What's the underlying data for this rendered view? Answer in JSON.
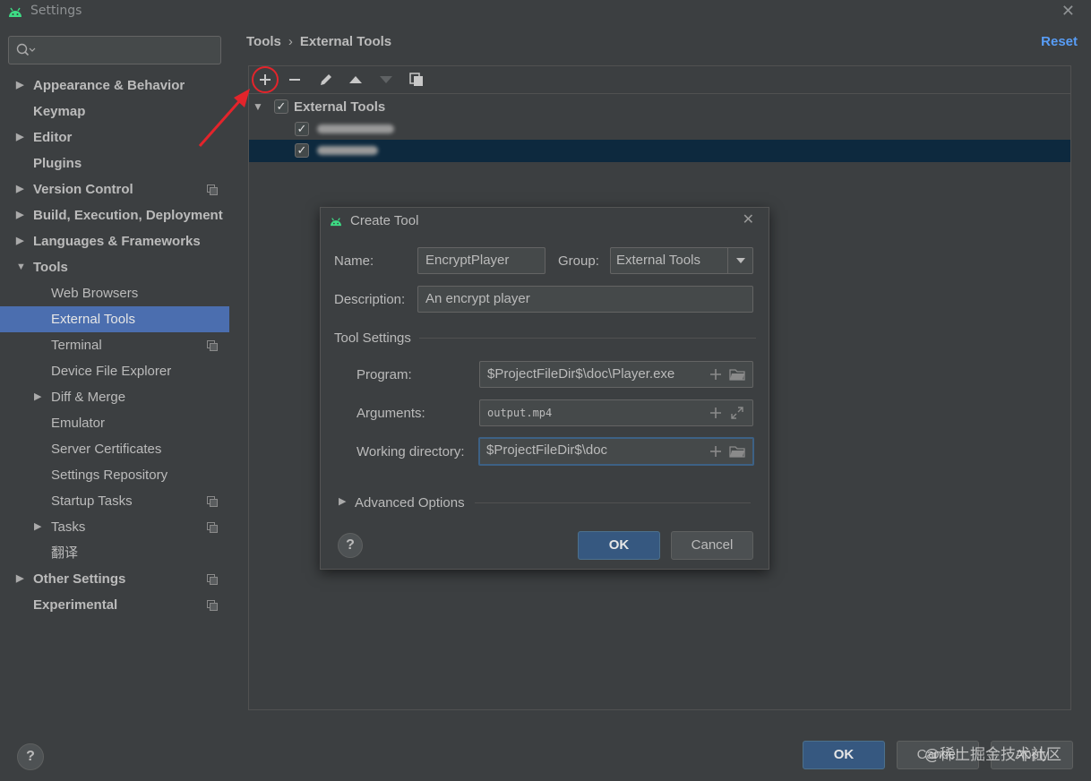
{
  "window": {
    "title": "Settings",
    "close_glyph": "✕"
  },
  "search": {
    "placeholder": "",
    "icon": "search-icon"
  },
  "sidebar": {
    "items": [
      {
        "label": "Appearance & Behavior",
        "arrow": "▶"
      },
      {
        "label": "Keymap"
      },
      {
        "label": "Editor",
        "arrow": "▶"
      },
      {
        "label": "Plugins"
      },
      {
        "label": "Version Control",
        "arrow": "▶"
      },
      {
        "label": "Build, Execution, Deployment",
        "arrow": "▶"
      },
      {
        "label": "Languages & Frameworks",
        "arrow": "▶"
      },
      {
        "label": "Tools",
        "arrow": "▼"
      },
      {
        "label": "Web Browsers"
      },
      {
        "label": "External Tools"
      },
      {
        "label": "Terminal"
      },
      {
        "label": "Device File Explorer"
      },
      {
        "label": "Diff & Merge",
        "arrow": "▶"
      },
      {
        "label": "Emulator"
      },
      {
        "label": "Server Certificates"
      },
      {
        "label": "Settings Repository"
      },
      {
        "label": "Startup Tasks"
      },
      {
        "label": "Tasks",
        "arrow": "▶"
      },
      {
        "label": "翻译"
      },
      {
        "label": "Other Settings",
        "arrow": "▶"
      },
      {
        "label": "Experimental"
      }
    ]
  },
  "breadcrumb": {
    "parent": "Tools",
    "separator": "›",
    "current": "External Tools"
  },
  "reset_label": "Reset",
  "tool_tree": {
    "group": {
      "label": "External Tools",
      "checked": "✓",
      "arrow": "▼"
    },
    "items": [
      {
        "checked": "✓"
      },
      {
        "checked": "✓"
      }
    ]
  },
  "dialog": {
    "title": "Create Tool",
    "close_glyph": "✕",
    "name_label": "Name:",
    "name_value": "EncryptPlayer",
    "group_label": "Group:",
    "group_value": "External Tools",
    "description_label": "Description:",
    "description_value": "An encrypt player",
    "tool_settings_label": "Tool Settings",
    "program_label": "Program:",
    "program_value": "$ProjectFileDir$\\doc\\Player.exe",
    "arguments_label": "Arguments:",
    "arguments_value": "output.mp4",
    "working_dir_label": "Working directory:",
    "working_dir_value": "$ProjectFileDir$\\doc",
    "advanced_options_label": "Advanced Options",
    "advanced_arrow": "▶",
    "help_label": "?",
    "ok_label": "OK",
    "cancel_label": "Cancel"
  },
  "footer": {
    "help_label": "?",
    "ok_label": "OK",
    "cancel_label": "Cancel",
    "apply_label": "Apply",
    "watermark": "@稀土掘金技术社区"
  },
  "colors": {
    "accent": "#4b6eaf",
    "link": "#589df6",
    "annotation": "#e3242b",
    "android": "#3ddc84"
  }
}
